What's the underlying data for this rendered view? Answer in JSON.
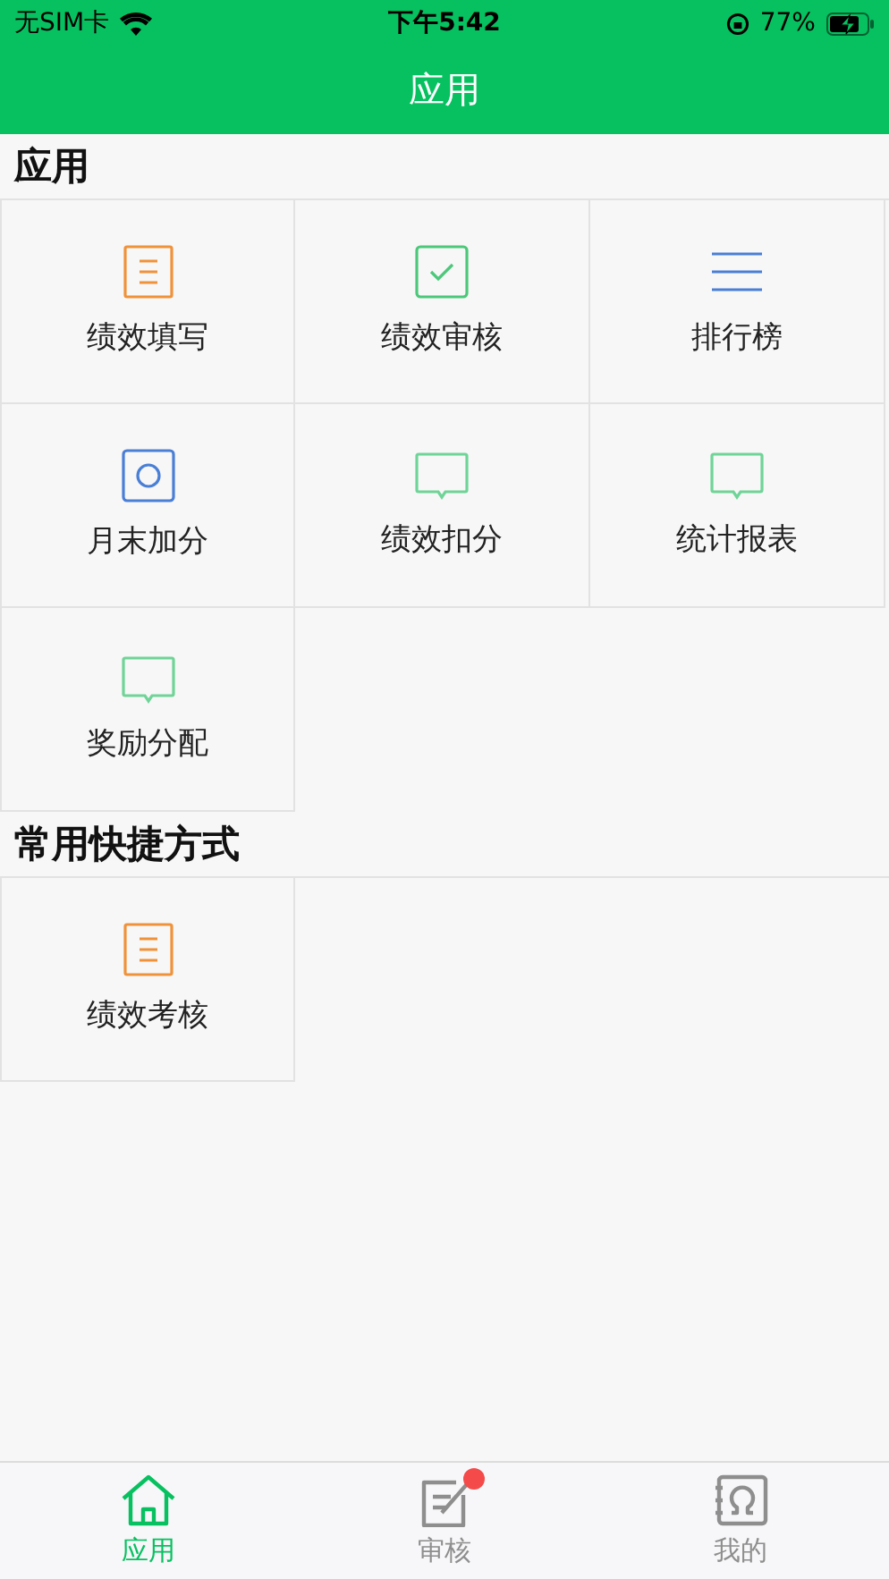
{
  "status_bar": {
    "carrier": "无SIM卡",
    "time": "下午5:42",
    "battery": "77%"
  },
  "nav": {
    "title": "应用"
  },
  "sections": [
    {
      "title": "应用",
      "items": [
        {
          "label": "绩效填写",
          "kind": "document",
          "color": "#f0923a"
        },
        {
          "label": "绩效审核",
          "kind": "check",
          "color": "#4cc87a"
        },
        {
          "label": "排行榜",
          "kind": "list",
          "color": "#4a7fd6"
        },
        {
          "label": "月末加分",
          "kind": "circle",
          "color": "#4a7fd6"
        },
        {
          "label": "绩效扣分",
          "kind": "chat",
          "color": "#6fd497"
        },
        {
          "label": "统计报表",
          "kind": "chat",
          "color": "#6fd497"
        },
        {
          "label": "奖励分配",
          "kind": "chat",
          "color": "#6fd497"
        }
      ]
    },
    {
      "title": "常用快捷方式",
      "items": [
        {
          "label": "绩效考核",
          "kind": "document",
          "color": "#f0923a"
        }
      ]
    }
  ],
  "tabs": [
    {
      "label": "应用",
      "kind": "home",
      "selected": true,
      "badge": false
    },
    {
      "label": "审核",
      "kind": "edit",
      "selected": false,
      "badge": true
    },
    {
      "label": "我的",
      "kind": "contacts",
      "selected": false,
      "badge": false
    }
  ]
}
